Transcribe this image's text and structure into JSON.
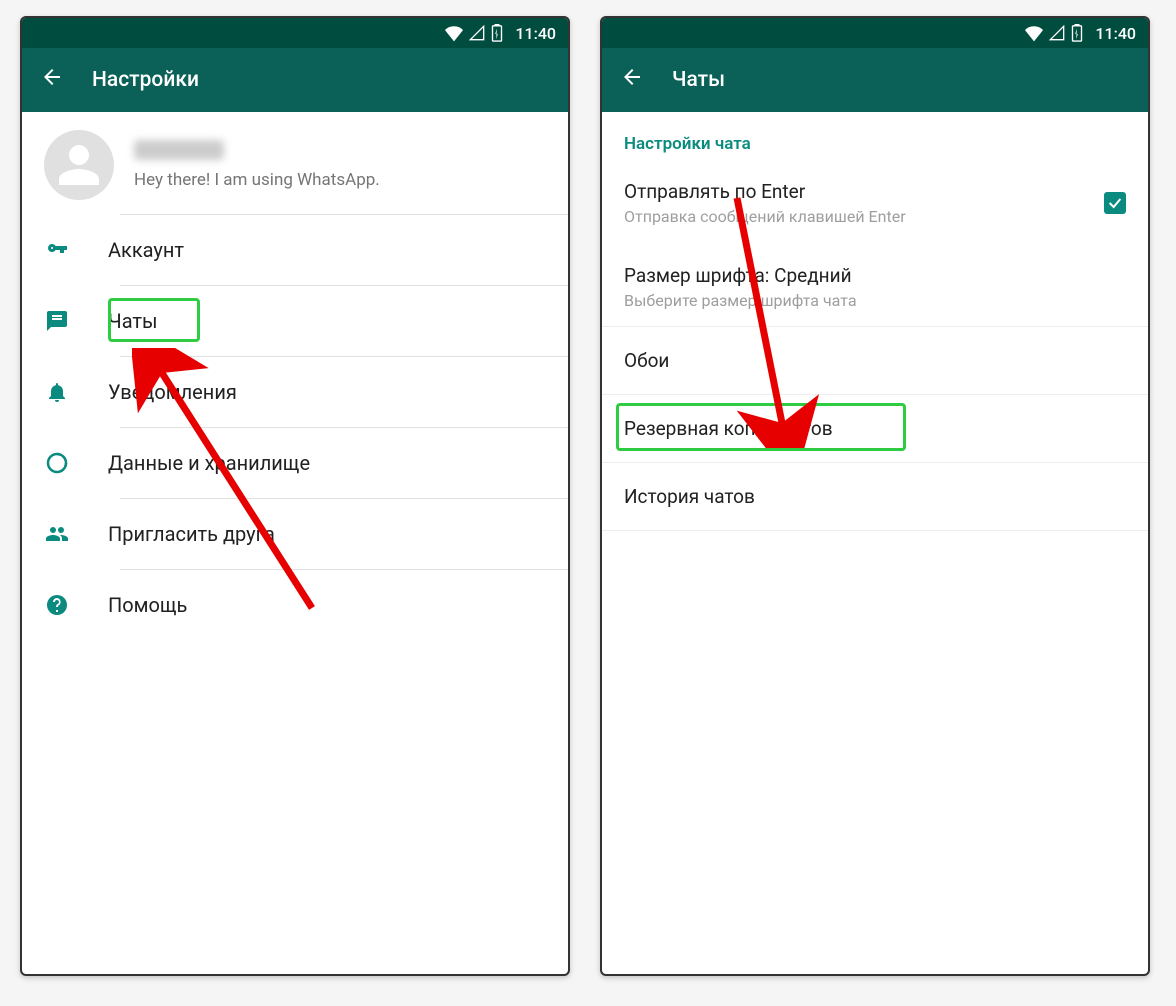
{
  "status": {
    "time": "11:40"
  },
  "left": {
    "title": "Настройки",
    "profile_status": "Hey there! I am using WhatsApp.",
    "items": [
      {
        "label": "Аккаунт",
        "icon": "key"
      },
      {
        "label": "Чаты",
        "icon": "chat"
      },
      {
        "label": "Уведомления",
        "icon": "bell"
      },
      {
        "label": "Данные и хранилище",
        "icon": "data"
      },
      {
        "label": "Пригласить друга",
        "icon": "people"
      },
      {
        "label": "Помощь",
        "icon": "help"
      }
    ]
  },
  "right": {
    "title": "Чаты",
    "section": "Настройки чата",
    "enter": {
      "primary": "Отправлять по Enter",
      "secondary": "Отправка сообщений клавишей Enter",
      "checked": true
    },
    "font": {
      "primary": "Размер шрифта: Средний",
      "secondary": "Выберите размер шрифта чата"
    },
    "wallpaper": "Обои",
    "backup": "Резервная копия чатов",
    "history": "История чатов"
  }
}
